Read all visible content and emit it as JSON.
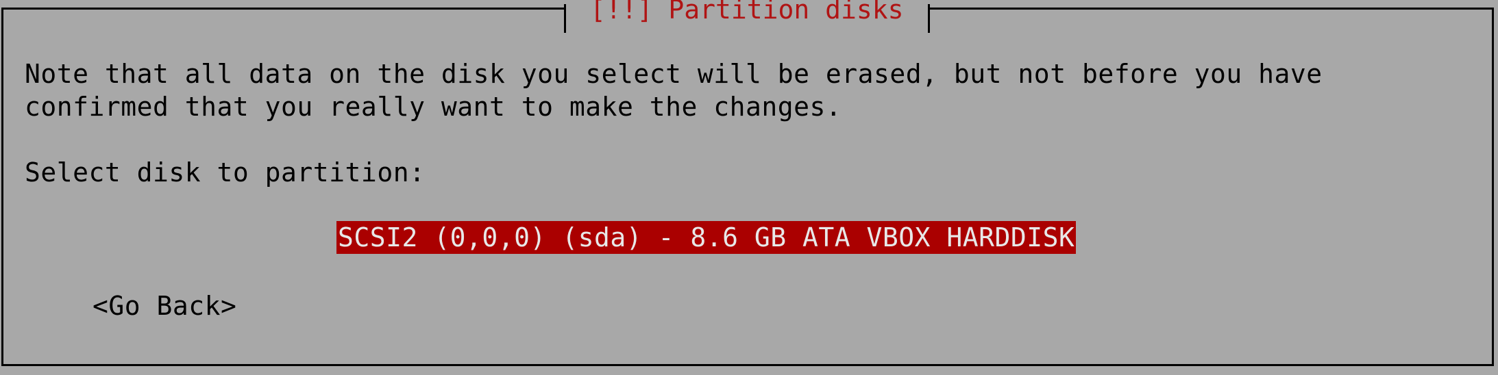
{
  "dialog": {
    "title": "[!!] Partition disks",
    "message_line1": "Note that all data on the disk you select will be erased, but not before you have",
    "message_line2": "confirmed that you really want to make the changes.",
    "prompt": "Select disk to partition:",
    "disks": [
      {
        "label": "SCSI2 (0,0,0) (sda) - 8.6 GB ATA VBOX HARDDISK",
        "selected": true
      }
    ],
    "go_back_label": "<Go Back>"
  },
  "colors": {
    "background": "#a8a8a8",
    "title": "#b01414",
    "selection_bg": "#aa0000",
    "selection_fg": "#e8e8e8"
  }
}
